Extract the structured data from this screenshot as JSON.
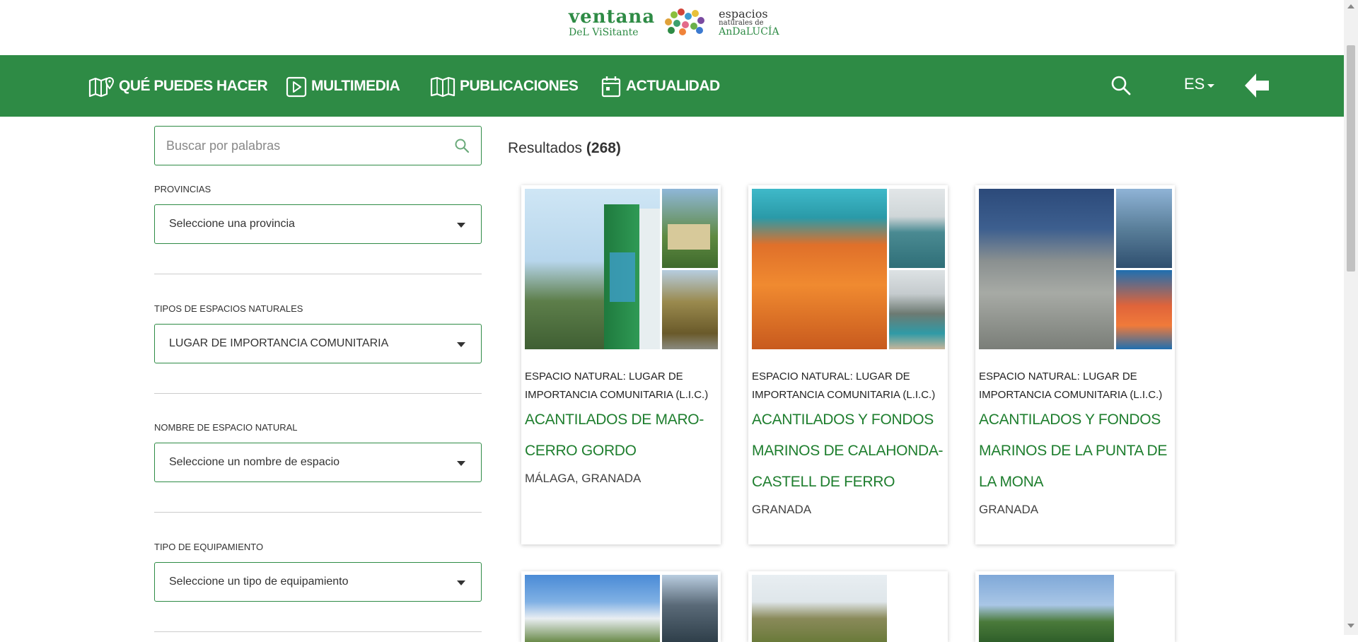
{
  "header": {
    "logo_left_line1": "ventana",
    "logo_left_line2": "DeL ViSitante",
    "logo_right_line1": "espacios",
    "logo_right_line2": "naturales de",
    "logo_right_line3": "AnDaLUCÍA"
  },
  "nav": {
    "items": [
      {
        "label": "QUÉ PUEDES HACER",
        "icon": "map-pin-icon"
      },
      {
        "label": "MULTIMEDIA",
        "icon": "play-icon"
      },
      {
        "label": "PUBLICACIONES",
        "icon": "book-icon"
      },
      {
        "label": "ACTUALIDAD",
        "icon": "calendar-icon"
      }
    ],
    "lang": "ES",
    "colors": {
      "green": "#2e8b45"
    }
  },
  "sidebar": {
    "search_placeholder": "Buscar por palabras",
    "filters": [
      {
        "label": "PROVINCIAS",
        "value": "Seleccione una provincia"
      },
      {
        "label": "TIPOS DE ESPACIOS NATURALES",
        "value": "LUGAR DE IMPORTANCIA COMUNITARIA"
      },
      {
        "label": "NOMBRE DE ESPACIO NATURAL",
        "value": "Seleccione un nombre de espacio"
      },
      {
        "label": "TIPO DE EQUIPAMIENTO",
        "value": "Seleccione un tipo de equipamiento"
      }
    ]
  },
  "results": {
    "label": "Resultados",
    "count": "(268)"
  },
  "cards": [
    {
      "type": "ESPACIO NATURAL: LUGAR DE IMPORTANCIA COMUNITARIA (L.I.C.)",
      "title": "ACANTILADOS DE MARO-CERRO GORDO",
      "location": "MÁLAGA, GRANADA"
    },
    {
      "type": "ESPACIO NATURAL: LUGAR DE IMPORTANCIA COMUNITARIA (L.I.C.)",
      "title": "ACANTILADOS Y FONDOS MARINOS DE CALAHONDA-CASTELL DE FERRO",
      "location": "GRANADA"
    },
    {
      "type": "ESPACIO NATURAL: LUGAR DE IMPORTANCIA COMUNITARIA (L.I.C.)",
      "title": "ACANTILADOS Y FONDOS MARINOS DE LA PUNTA DE LA MONA",
      "location": "GRANADA"
    }
  ]
}
